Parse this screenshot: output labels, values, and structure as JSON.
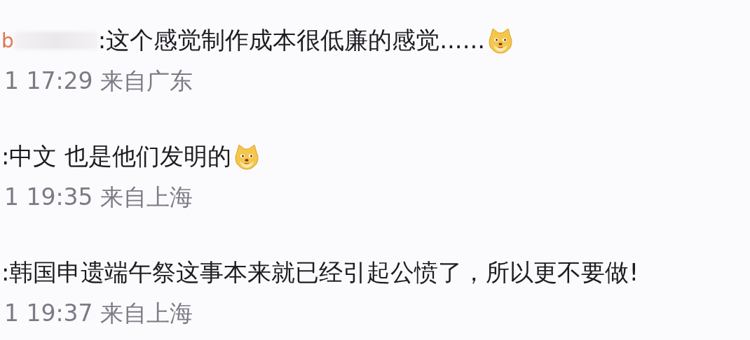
{
  "comments": [
    {
      "author": "b",
      "author_redacted": true,
      "text": ":这个感觉制作成本很低廉的感觉......",
      "emoji": true,
      "meta": "1 17:29 来自广东"
    },
    {
      "text": ":中文 也是他们发明的",
      "emoji": true,
      "meta": "1 19:35 来自上海"
    },
    {
      "text": ":韩国申遗端午祭这事本来就已经引起公愤了，所以更不要做!",
      "emoji": false,
      "meta": "1 19:37 来自上海"
    }
  ]
}
